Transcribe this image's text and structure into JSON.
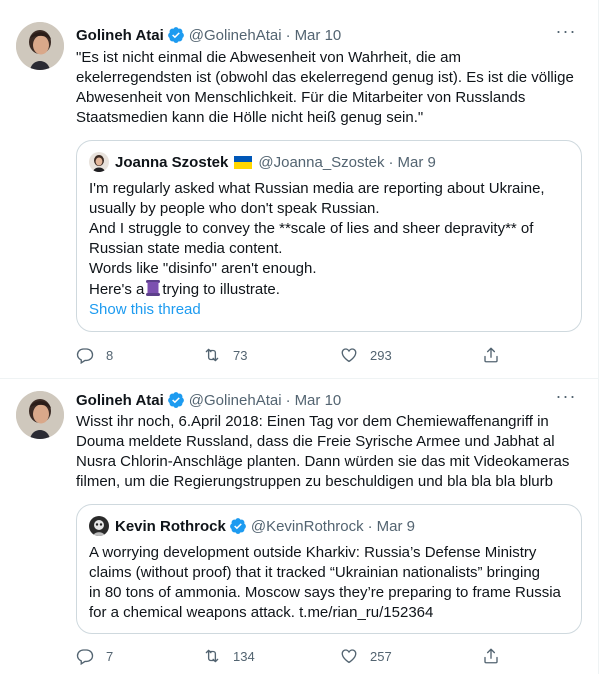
{
  "tweets": [
    {
      "author": {
        "name": "Golineh Atai",
        "handle": "@GolinehAtai",
        "verified": true
      },
      "date": "Mar 10",
      "text_lines": [
        "\"Es ist nicht einmal die Abwesenheit von Wahrheit, die am",
        "ekelerregendsten ist (obwohl das ekelerregend genug ist). Es ist die völlige",
        "Abwesenheit von Menschlichkeit. Für die Mitarbeiter von Russlands",
        "Staatsmedien kann die Hölle nicht heiß genug sein.\""
      ],
      "quote": {
        "author": {
          "name": "Joanna Szostek",
          "handle": "@Joanna_Szostek",
          "flag": "ukraine-flag"
        },
        "date": "Mar 9",
        "text_lines": [
          "I'm regularly asked what Russian media are reporting about Ukraine,",
          "usually by people who don't speak Russian.",
          "And I struggle to convey the **scale of lies and sheer depravity** of",
          "Russian state media content.",
          "Words like \"disinfo\" aren't enough."
        ],
        "last_line_before_emoji": "Here's a",
        "last_line_after_emoji": "trying to illustrate.",
        "emoji": "scroll-emoji",
        "show_thread": "Show this thread"
      },
      "replies": "8",
      "retweets": "73",
      "likes": "293"
    },
    {
      "author": {
        "name": "Golineh Atai",
        "handle": "@GolinehAtai",
        "verified": true
      },
      "date": "Mar 10",
      "text_lines": [
        "Wisst ihr noch, 6.April 2018: Einen Tag vor dem Chemiewaffenangriff in",
        "Douma meldete Russland, dass die Freie Syrische Armee und Jabhat al",
        "Nusra Chlorin-Anschläge planten. Dann würden sie das mit Videokameras",
        "filmen, um die Regierungstruppen zu beschuldigen und bla bla bla blurb"
      ],
      "quote": {
        "author": {
          "name": "Kevin Rothrock",
          "handle": "@KevinRothrock",
          "verified": true
        },
        "date": "Mar 9",
        "text_lines": [
          "A worrying development outside Kharkiv: Russia’s Defense Ministry",
          "claims (without proof) that it tracked “Ukrainian nationalists” bringing",
          "in 80 tons of ammonia. Moscow says they’re preparing to frame Russia",
          "for a chemical weapons attack. t.me/rian_ru/152364"
        ]
      },
      "replies": "7",
      "retweets": "134",
      "likes": "257"
    }
  ],
  "ui": {
    "separator": "·",
    "more_glyph": "···",
    "colors": {
      "link": "#1d9bf0",
      "muted": "#536471",
      "text": "#0f1419",
      "border": "#cfd9de"
    }
  }
}
